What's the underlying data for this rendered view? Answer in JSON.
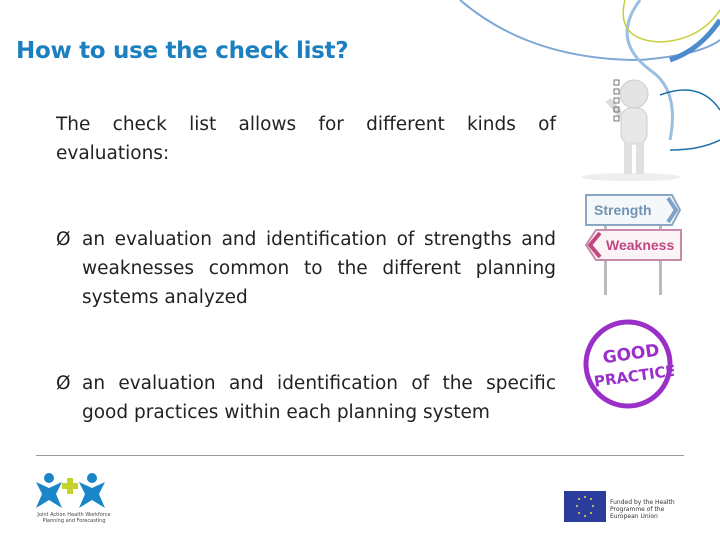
{
  "title": "How to use the check list?",
  "intro": "The check list allows for different kinds of evaluations:",
  "bullets": [
    {
      "marker": "Ø",
      "text": "an evaluation and identification of strengths and weaknesses common to the different planning systems analyzed"
    },
    {
      "marker": "Ø",
      "text": "an evaluation and identification of the specific good practices within each planning system"
    }
  ],
  "images": {
    "signs": {
      "strength": "Strength",
      "weakness": "Weakness"
    },
    "stamp": {
      "line1": "GOOD",
      "line2": "PRACTICE"
    }
  },
  "footer": {
    "left_logo_caption": "Joint Action Health Workforce Planning and Forecasting",
    "right_logo_caption": "Funded by the Health Programme of the European Union"
  },
  "colors": {
    "title": "#1b7fc0",
    "strength": "#6f93b4",
    "weakness": "#c2467f",
    "stamp": "#9b30c8",
    "eu_blue": "#2a3d9a"
  }
}
